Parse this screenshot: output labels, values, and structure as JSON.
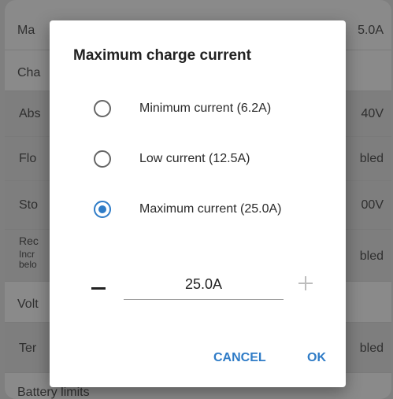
{
  "background": {
    "rows": [
      {
        "label": "Ma",
        "value": "5.0A"
      },
      {
        "label": "Cha",
        "value": ""
      },
      {
        "label": "Abs",
        "value": "40V"
      },
      {
        "label": "Flo",
        "value": "bled"
      },
      {
        "label": "Sto",
        "value": "00V"
      },
      {
        "label": "Rec",
        "label2": "Incr",
        "label3": "belo",
        "value": "bled"
      },
      {
        "label": "Volt",
        "value": ""
      },
      {
        "label": "Ter",
        "value": "bled"
      },
      {
        "label": "Battery limits",
        "value": ""
      }
    ]
  },
  "dialog": {
    "title": "Maximum charge current",
    "options": [
      {
        "label": "Minimum current (6.2A)",
        "selected": false
      },
      {
        "label": "Low current (12.5A)",
        "selected": false
      },
      {
        "label": "Maximum current (25.0A)",
        "selected": true
      }
    ],
    "stepper": {
      "value": "25.0A"
    },
    "buttons": {
      "cancel": "CANCEL",
      "ok": "OK"
    }
  },
  "colors": {
    "accent": "#2f7cc7"
  }
}
